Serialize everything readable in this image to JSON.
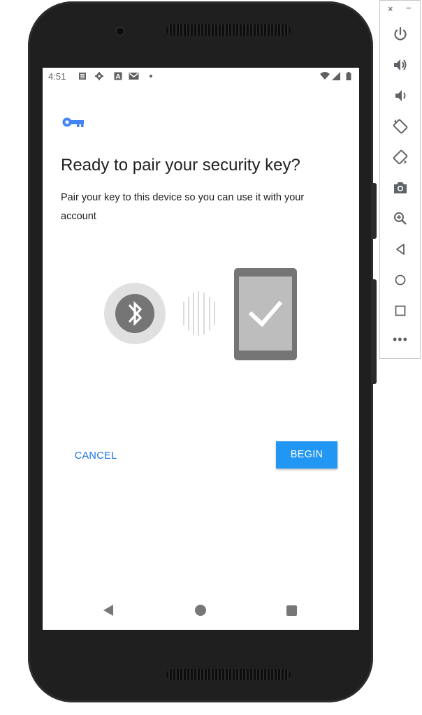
{
  "status_bar": {
    "time": "4:51"
  },
  "dialog": {
    "title": "Ready to pair your security key?",
    "description": "Pair your key to this device so you can use it with your account",
    "cancel_label": "CANCEL",
    "begin_label": "BEGIN"
  },
  "colors": {
    "accent": "#1a73e8",
    "begin_button": "#2196f3",
    "key_icon": "#4285f4",
    "illustration_gray": "#757575"
  },
  "emulator_toolbar": {
    "close_label": "×",
    "minimize_label": "−",
    "more_label": "•••",
    "buttons": [
      "power-icon",
      "volume-up-icon",
      "volume-down-icon",
      "rotate-left-icon",
      "rotate-right-icon",
      "camera-icon",
      "zoom-icon",
      "back-icon",
      "home-icon",
      "overview-icon"
    ]
  }
}
